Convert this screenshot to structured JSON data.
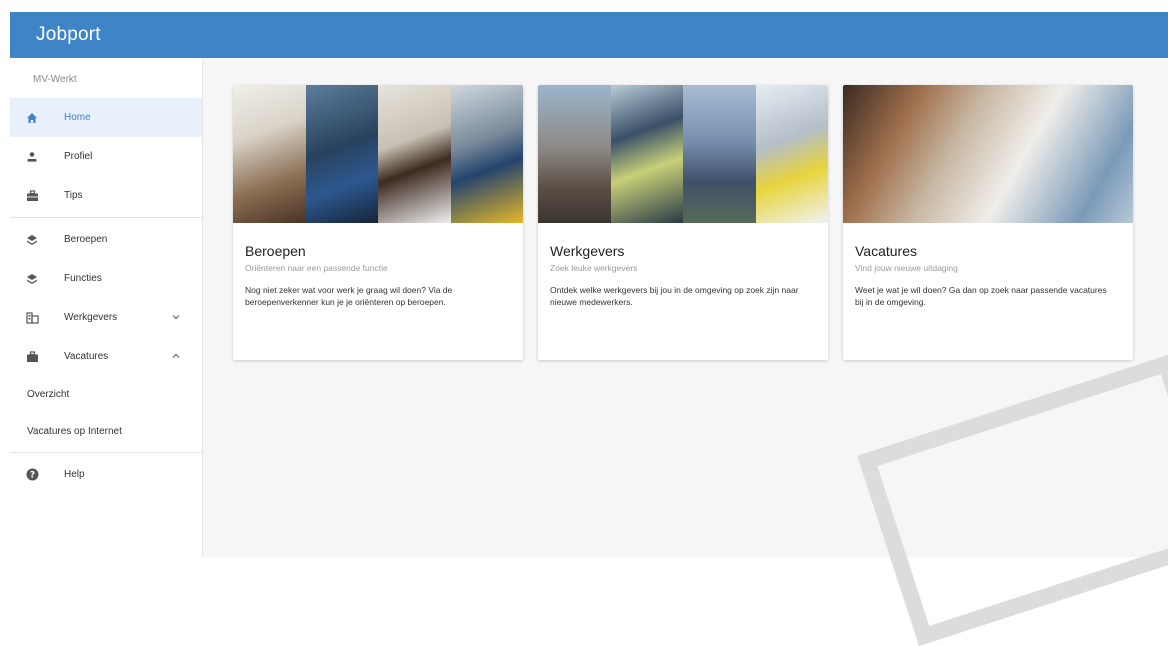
{
  "app": {
    "title": "Jobport",
    "org": "MV-Werkt"
  },
  "sidebar": {
    "items": [
      {
        "label": "Home",
        "icon": "home-icon"
      },
      {
        "label": "Profiel",
        "icon": "person-icon"
      },
      {
        "label": "Tips",
        "icon": "briefcase-icon"
      },
      {
        "label": "Beroepen",
        "icon": "layers-icon"
      },
      {
        "label": "Functies",
        "icon": "layers-icon"
      },
      {
        "label": "Werkgevers",
        "icon": "building-icon"
      },
      {
        "label": "Vacatures",
        "icon": "briefcase-icon"
      }
    ],
    "sub_items": [
      {
        "label": "Overzicht"
      },
      {
        "label": "Vacatures op Internet"
      }
    ],
    "help": {
      "label": "Help",
      "icon": "help-icon"
    }
  },
  "cards": [
    {
      "title": "Beroepen",
      "subtitle": "Oriënteren naar een passende functie",
      "text": "Nog niet zeker wat voor werk je graag wil doen? Via de beroepenverkenner kun je je oriënteren op beroepen."
    },
    {
      "title": "Werkgevers",
      "subtitle": "Zoek leuke werkgevers",
      "text": "Ontdek welke werkgevers bij jou in de omgeving op zoek zijn naar nieuwe medewerkers."
    },
    {
      "title": "Vacatures",
      "subtitle": "Vind jouw nieuwe uitdaging",
      "text": "Weet je wat je wil doen? Ga dan op zoek naar passende vacatures bij in de omgeving."
    }
  ],
  "colors": {
    "accent": "#3f85c6",
    "active_bg": "#e8f0fb"
  }
}
